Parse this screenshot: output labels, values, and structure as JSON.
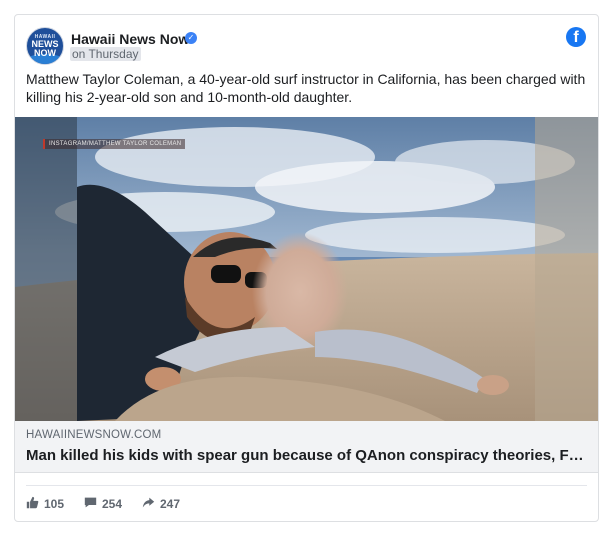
{
  "post": {
    "page_name": "Hawaii News Now",
    "timestamp": "on Thursday",
    "caption": "Matthew Taylor Coleman, a 40-year-old surf instructor in California, has been charged with killing his 2-year-old son and 10-month-old daughter.",
    "avatar": {
      "line_small": "HAWAII",
      "line1": "NEWS",
      "line2": "NOW"
    }
  },
  "photo": {
    "watermark": "INSTAGRAM/MATTHEW TAYLOR COLEMAN"
  },
  "link": {
    "domain": "HAWAIINEWSNOW.COM",
    "headline": "Man killed his kids with spear gun because of QAnon conspiracy theories, FBI says"
  },
  "stats": {
    "likes": "105",
    "comments": "254",
    "shares": "247"
  },
  "colors": {
    "facebook_blue": "#1877f2",
    "verified_blue": "#3b82f6",
    "muted_text": "#606770",
    "link_bg": "#f2f3f5"
  },
  "icons": [
    "verified-badge-icon",
    "facebook-logo-icon",
    "like-thumb-icon",
    "comment-bubble-icon",
    "share-arrow-icon"
  ]
}
